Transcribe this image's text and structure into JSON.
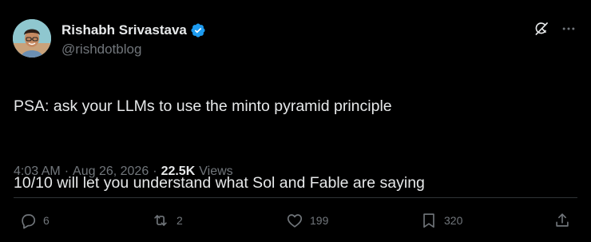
{
  "author": {
    "display_name": "Rishabh Srivastava",
    "handle": "@rishdotblog",
    "verified": true,
    "avatar_icon": "avatar-photo"
  },
  "tweet": {
    "line1": "PSA: ask your LLMs to use the minto pyramid principle",
    "line2": "10/10 will let you understand what Sol and Fable are saying"
  },
  "meta": {
    "time": "4:03 AM",
    "separator1": "·",
    "date": "Aug 26, 2026",
    "separator2": "·",
    "views_count": "22.5K",
    "views_label": "Views"
  },
  "actions": {
    "replies": "6",
    "reposts": "2",
    "likes": "199",
    "bookmarks": "320"
  },
  "icons": {
    "grok": "grok-icon",
    "more": "more-icon",
    "reply": "reply-icon",
    "repost": "repost-icon",
    "like": "heart-icon",
    "bookmark": "bookmark-icon",
    "share": "share-icon",
    "verified": "verified-badge-icon"
  },
  "colors": {
    "background": "#000000",
    "text": "#e7e9ea",
    "muted": "#71767b",
    "verified": "#1d9bf0"
  }
}
